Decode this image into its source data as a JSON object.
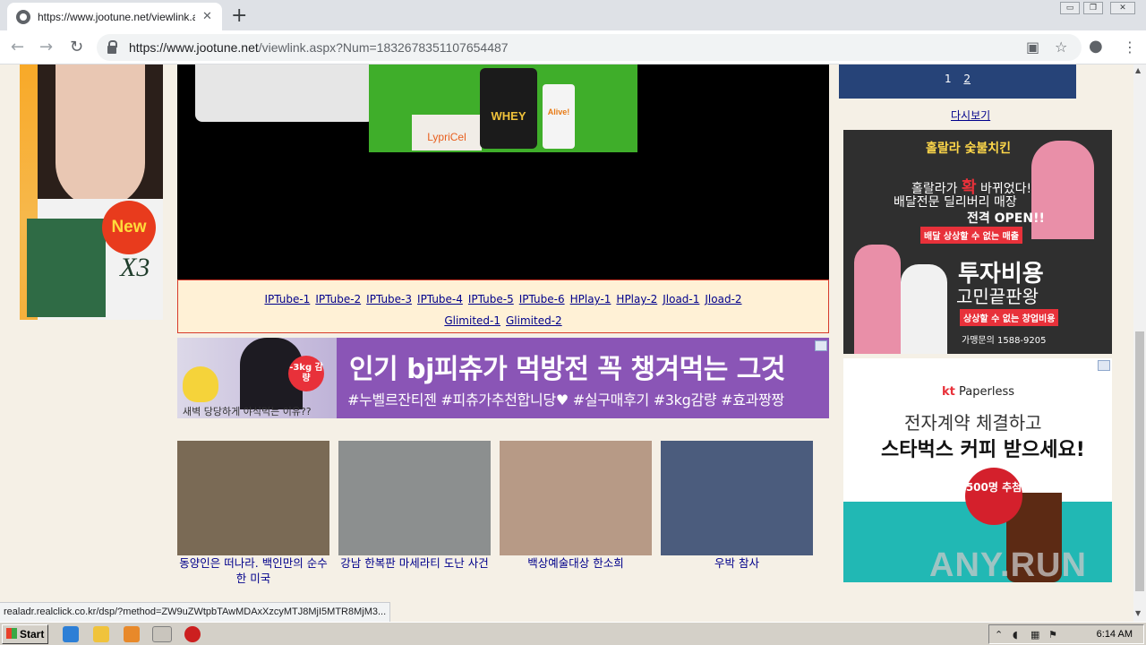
{
  "browser": {
    "tab_title": "https://www.jootune.net/viewlink.a",
    "tab_close": "✕",
    "new_tab": "+",
    "url_host": "https://www.jootune.net",
    "url_path": "/viewlink.aspx?Num=1832678351107654487",
    "window_controls": [
      "▭",
      "❐",
      "✕"
    ]
  },
  "left_ad": {
    "badge": "New",
    "brand_mark": "X3"
  },
  "video_ad": {
    "product1": "WHEY",
    "product2": "Alive!",
    "product3": "LypriCel"
  },
  "links": {
    "row1": [
      "IPTube-1",
      "IPTube-2",
      "IPTube-3",
      "IPTube-4",
      "IPTube-5",
      "IPTube-6",
      "HPlay-1",
      "HPlay-2",
      "Jload-1",
      "Jload-2"
    ],
    "row2": [
      "Glimited-1",
      "Glimited-2"
    ]
  },
  "banner": {
    "headline": "인기 bj피츄가 먹방전 꼭 챙겨먹는 그것",
    "tags": "#누벨르잔티젠 #피츄가추천합니당♥ #실구매후기 #3kg감량 #효과짱짱",
    "badge": "-3kg 감량",
    "subline": "새벽 당당하게 야식먹는 이유??"
  },
  "thumbnails": [
    {
      "caption": "동양인은 떠나라. 백인만의 순수한 미국",
      "color": "#7a6a55"
    },
    {
      "caption": "강남 한복판 마세라티 도난 사건",
      "color": "#8c8f8f"
    },
    {
      "caption": "백상예술대상 한소희",
      "color": "#b79a86"
    },
    {
      "caption": "우박 참사",
      "color": "#4b5c7d"
    }
  ],
  "right": {
    "pager": {
      "page1": "1",
      "page2": "2"
    },
    "replay": "다시보기",
    "chicken_ad": {
      "brand": "홀랄라 숯불치킨",
      "line1_pre": "홀랄라가",
      "line1_hi": "확",
      "line1_post": "바뀌었다!",
      "line2": "배달전문 딜리버리 매장",
      "line3": "전격 OPEN!!",
      "tag1": "배달 상상할 수 없는 매출",
      "big1": "투자비용",
      "big2": "고민끝판왕",
      "tag2": "상상할 수 없는 창업비용",
      "phone": "가맹문의 1588-9205"
    },
    "kt_ad": {
      "logo_kt": "kt",
      "logo_text": "Paperless",
      "h1": "전자계약 체결하고",
      "h2": "스타벅스 커피 받으세요!",
      "badge": "500명 추첨",
      "watermark": "ANY.RUN"
    }
  },
  "status_url": "realadr.realclick.co.kr/dsp/?method=ZW9uZWtpbTAwMDAxXzcyMTJ8MjI5MTR8MjM3...",
  "taskbar": {
    "start": "Start",
    "clock": "6:14 AM"
  }
}
